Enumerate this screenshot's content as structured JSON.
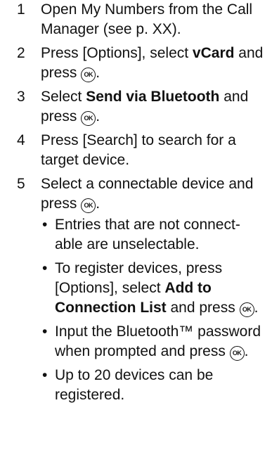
{
  "steps": [
    {
      "num": "1",
      "parts": [
        "Open My Numbers from the Call Manager (see p. XX)."
      ]
    },
    {
      "num": "2",
      "pre": "Press [Options], select ",
      "bold": "vCard",
      "post": " and press "
    },
    {
      "num": "3",
      "pre": "Select ",
      "bold": "Send via Bluetooth",
      "post": " and press "
    },
    {
      "num": "4",
      "parts": [
        "Press [Search] to search for a target device."
      ]
    },
    {
      "num": "5",
      "pre": "Select a connectable device and press "
    }
  ],
  "ok_icon": {
    "label": "OK",
    "icon": "ok-key-icon"
  },
  "bullets": [
    {
      "text": "Entries that are not connect-able are unselectable."
    },
    {
      "pre": "To register devices, press [Options], select ",
      "bold": "Add to Connection List",
      "post": " and press "
    },
    {
      "pre": "Input the Bluetooth™ password when prompted and press "
    },
    {
      "text": "Up to 20 devices can be registered."
    }
  ],
  "bullet_char": "•"
}
